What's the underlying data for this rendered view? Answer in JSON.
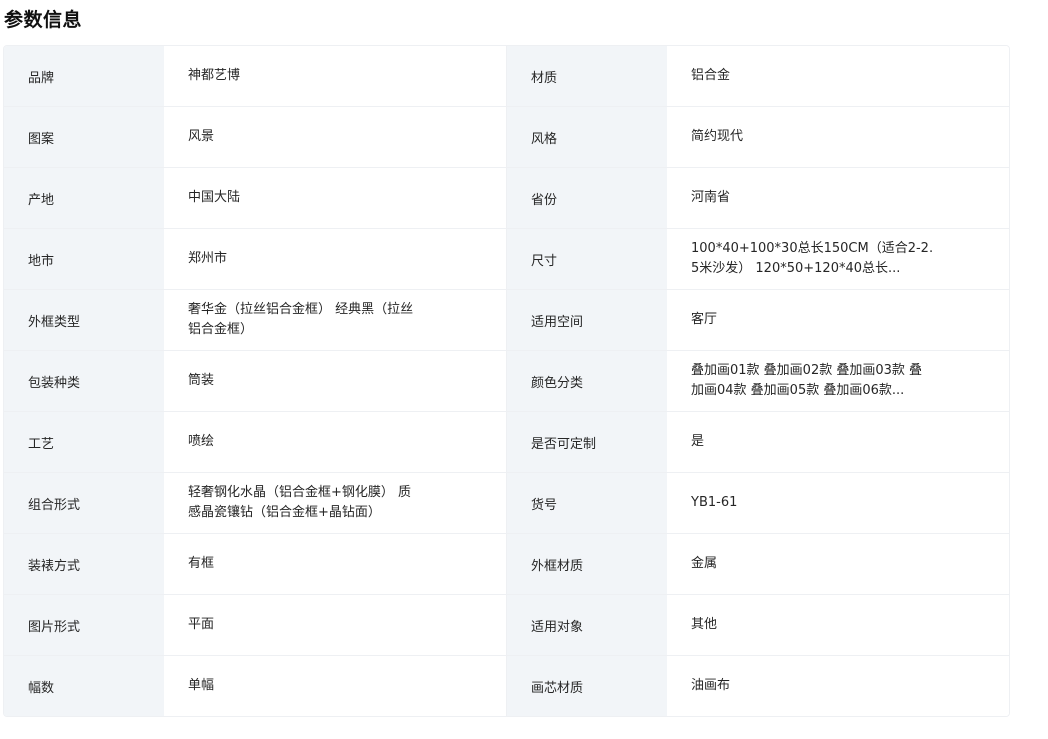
{
  "section": {
    "title": "参数信息"
  },
  "rows": [
    {
      "label_left": "品牌",
      "value_left": "神都艺博",
      "label_right": "材质",
      "value_right": "铝合金"
    },
    {
      "label_left": "图案",
      "value_left": "风景",
      "label_right": "风格",
      "value_right": "简约现代"
    },
    {
      "label_left": "产地",
      "value_left": "中国大陆",
      "label_right": "省份",
      "value_right": "河南省"
    },
    {
      "label_left": "地市",
      "value_left": "郑州市",
      "label_right": "尺寸",
      "value_right": "100*40+100*30总长150CM（适合2-2.5米沙发） 120*50+120*40总长..."
    },
    {
      "label_left": "外框类型",
      "value_left": "奢华金（拉丝铝合金框） 经典黑（拉丝铝合金框）",
      "label_right": "适用空间",
      "value_right": "客厅"
    },
    {
      "label_left": "包装种类",
      "value_left": "筒装",
      "label_right": "颜色分类",
      "value_right": "叠加画01款 叠加画02款 叠加画03款 叠加画04款 叠加画05款 叠加画06款..."
    },
    {
      "label_left": "工艺",
      "value_left": "喷绘",
      "label_right": "是否可定制",
      "value_right": "是"
    },
    {
      "label_left": "组合形式",
      "value_left": "轻奢钢化水晶（铝合金框+钢化膜） 质感晶瓷镶钻（铝合金框+晶钻面）",
      "label_right": "货号",
      "value_right": "YB1-61"
    },
    {
      "label_left": "装裱方式",
      "value_left": "有框",
      "label_right": "外框材质",
      "value_right": "金属"
    },
    {
      "label_left": "图片形式",
      "value_left": "平面",
      "label_right": "适用对象",
      "value_right": "其他"
    },
    {
      "label_left": "幅数",
      "value_left": "单幅",
      "label_right": "画芯材质",
      "value_right": "油画布"
    }
  ]
}
